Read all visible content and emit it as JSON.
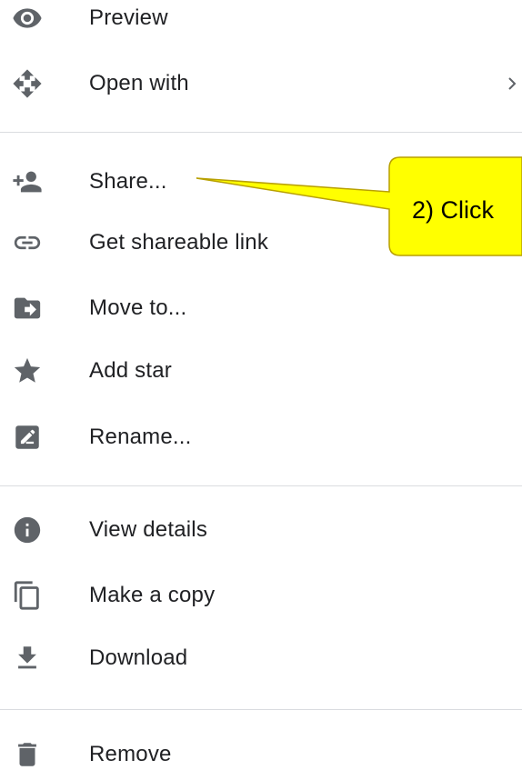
{
  "menu": {
    "items": [
      {
        "label": "Preview",
        "icon": "eye-icon"
      },
      {
        "label": "Open with",
        "icon": "move-arrows-icon",
        "has_submenu": true
      },
      {
        "label": "Share...",
        "icon": "person-add-icon"
      },
      {
        "label": "Get shareable link",
        "icon": "link-icon"
      },
      {
        "label": "Move to...",
        "icon": "folder-move-icon"
      },
      {
        "label": "Add star",
        "icon": "star-icon"
      },
      {
        "label": "Rename...",
        "icon": "rename-pencil-icon"
      },
      {
        "label": "View details",
        "icon": "info-icon"
      },
      {
        "label": "Make a copy",
        "icon": "copy-icon"
      },
      {
        "label": "Download",
        "icon": "download-icon"
      },
      {
        "label": "Remove",
        "icon": "trash-icon"
      }
    ],
    "submenu_chevron": "chevron-right-icon"
  },
  "callout": {
    "text": "2) Click",
    "fill_color": "#ffff00",
    "border_color": "#b8a000"
  },
  "colors": {
    "icon": "#5f6368",
    "text": "#202124",
    "divider": "#dadce0"
  }
}
